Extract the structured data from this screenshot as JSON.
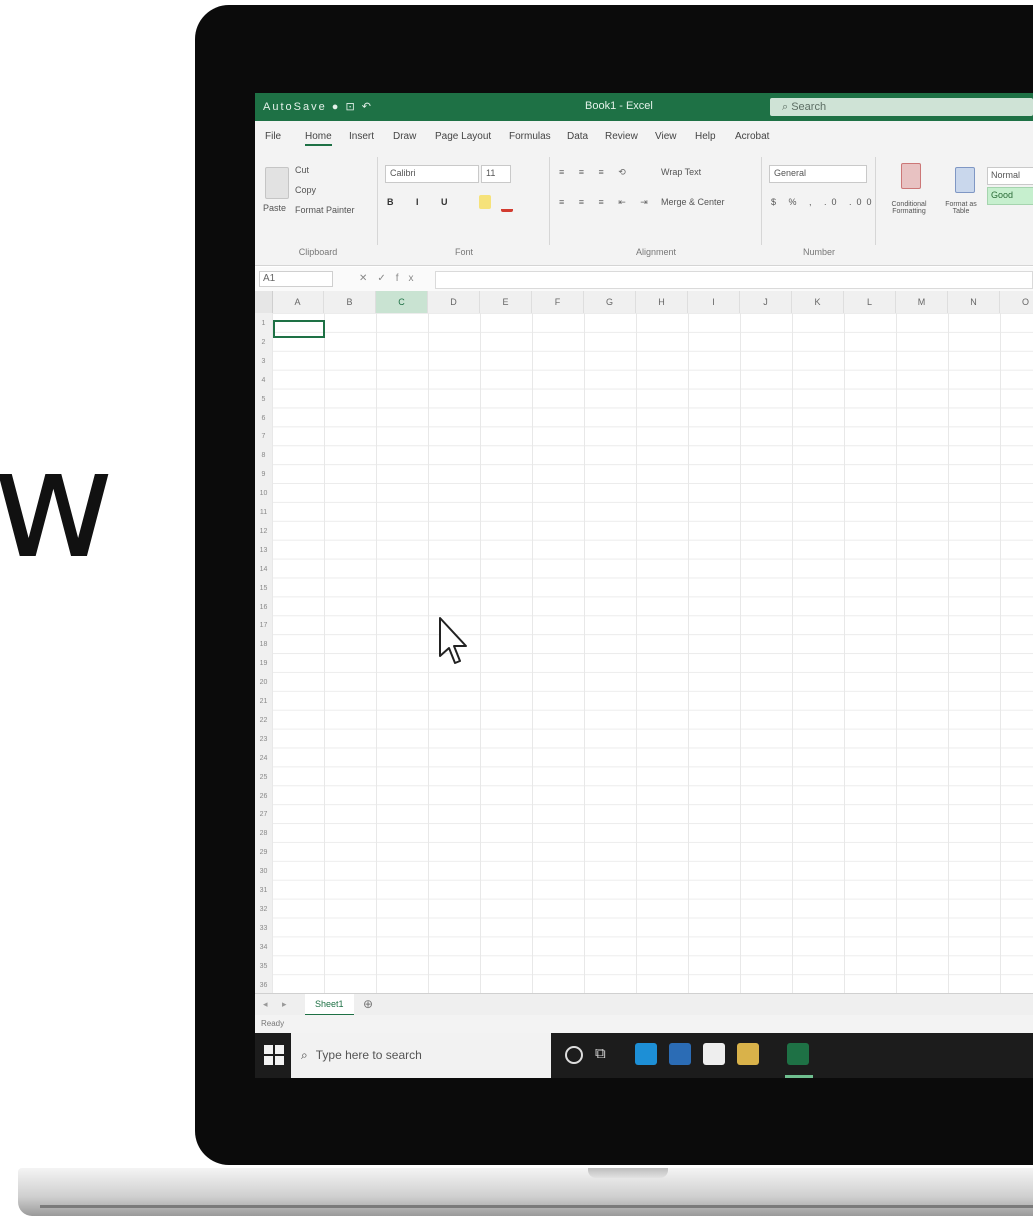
{
  "background": {
    "big_text": "w"
  },
  "excel": {
    "title_bar": {
      "quick_access": "AutoSave ● ⊡ ↶",
      "document_title": "Book1 - Excel",
      "search_placeholder": "Search",
      "color": "#1e7145"
    },
    "ribbon_tabs": [
      "File",
      "Home",
      "Insert",
      "Draw",
      "Page Layout",
      "Formulas",
      "Data",
      "Review",
      "View",
      "Help",
      "Acrobat"
    ],
    "active_tab": "Home",
    "ribbon_groups": {
      "clipboard": {
        "label": "Clipboard",
        "paste": "Paste",
        "cut": "Cut",
        "copy": "Copy",
        "format_painter": "Format Painter"
      },
      "font": {
        "label": "Font",
        "font_name": "Calibri",
        "font_size": "11"
      },
      "alignment": {
        "label": "Alignment",
        "wrap_text": "Wrap Text",
        "merge_center": "Merge & Center"
      },
      "number": {
        "label": "Number",
        "format": "General"
      },
      "styles": {
        "conditional_formatting": "Conditional Formatting",
        "format_as_table": "Format as Table",
        "normal": "Normal",
        "good": "Good"
      }
    },
    "formula_bar": {
      "name_box": "A1",
      "fx": "fx"
    },
    "columns": [
      "A",
      "B",
      "C",
      "D",
      "E",
      "F",
      "G",
      "H",
      "I",
      "J",
      "K",
      "L",
      "M",
      "N",
      "O"
    ],
    "selected_column": "C",
    "rows": [
      "1",
      "2",
      "3",
      "4",
      "5",
      "6",
      "7",
      "8",
      "9",
      "10",
      "11",
      "12",
      "13",
      "14",
      "15",
      "16",
      "17",
      "18",
      "19",
      "20",
      "21",
      "22",
      "23",
      "24",
      "25",
      "26",
      "27",
      "28",
      "29",
      "30",
      "31",
      "32",
      "33",
      "34",
      "35",
      "36"
    ],
    "sheet_tab": "Sheet1",
    "status": "Ready"
  },
  "taskbar": {
    "search_placeholder": "Type here to search"
  }
}
